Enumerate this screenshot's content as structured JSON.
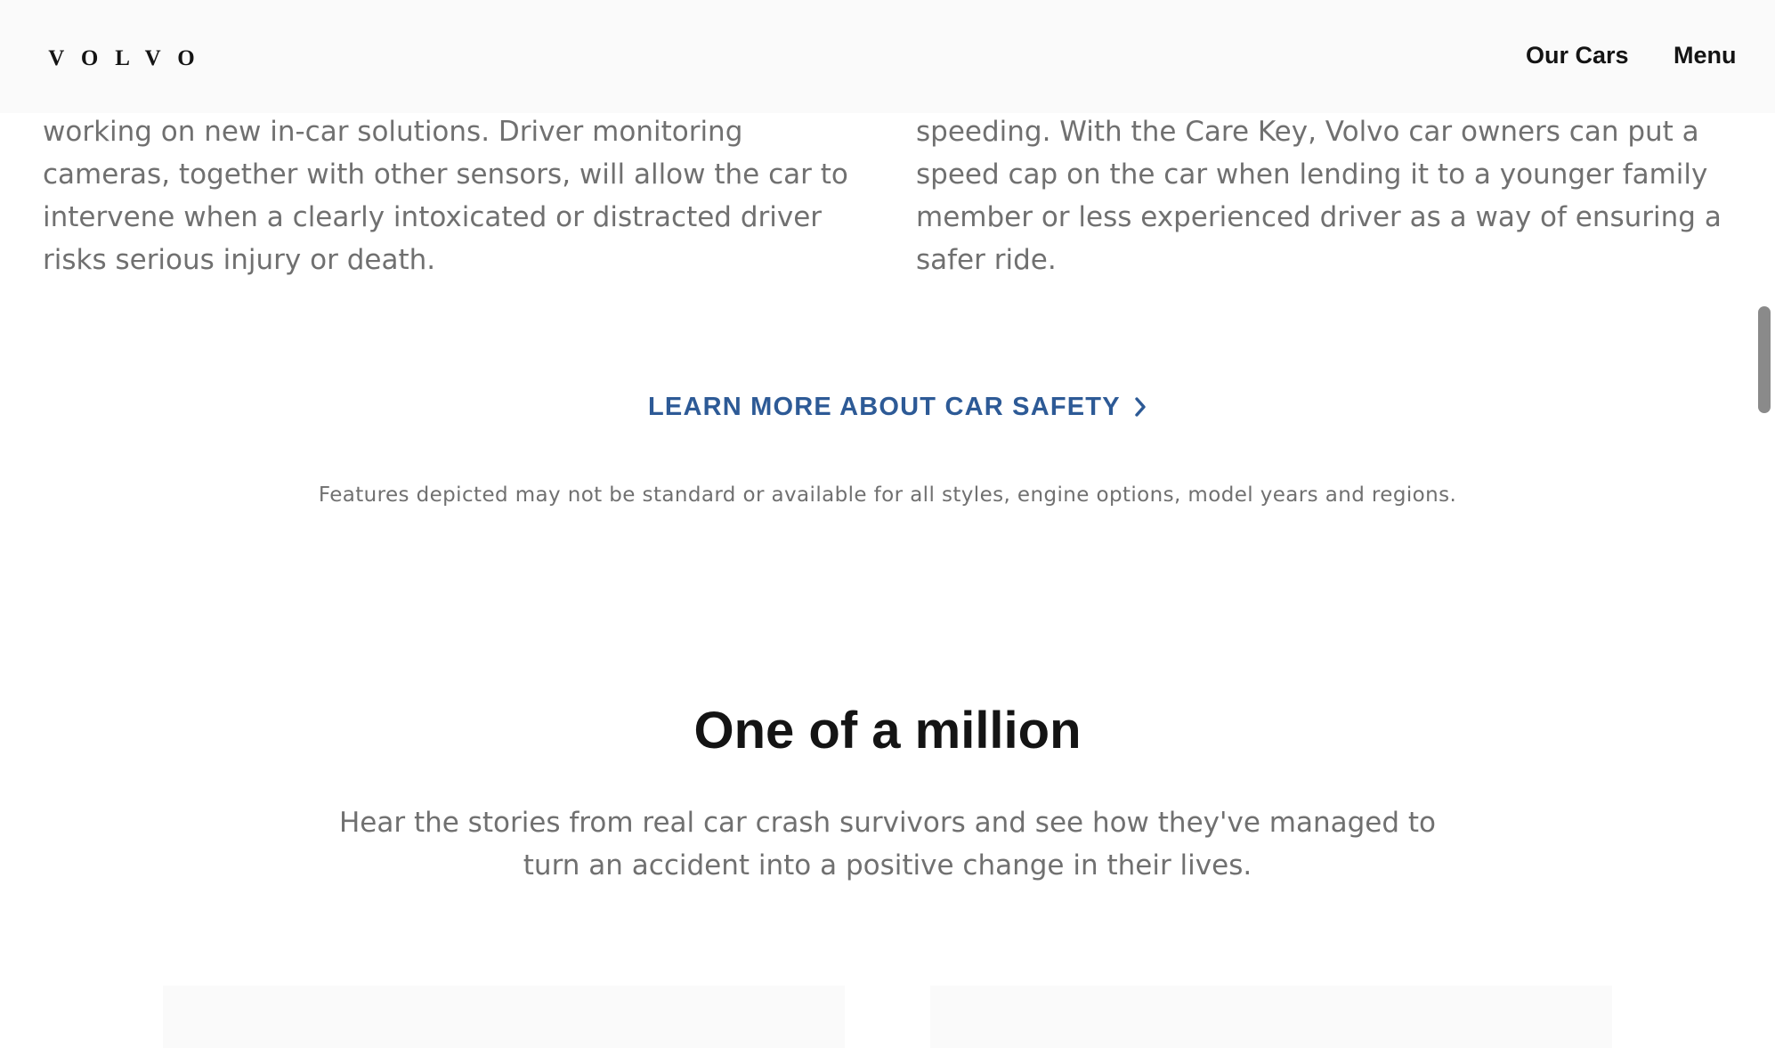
{
  "header": {
    "logo_text": "VOLVO",
    "nav": {
      "our_cars": "Our Cars",
      "menu": "Menu"
    }
  },
  "columns": {
    "left_text": "working on new in-car solutions. Driver monitoring cameras, together with other sensors, will allow the car to intervene when a clearly intoxicated or distracted driver risks serious injury or death.",
    "right_text": "speeding. With the Care Key, Volvo car owners can put a speed cap on the car when lending it to a younger family member or less experienced driver as a way of ensuring a safer ride."
  },
  "cta": {
    "label": "LEARN MORE ABOUT CAR SAFETY",
    "icon": "chevron-right-icon",
    "color": "#2d5a96"
  },
  "disclaimer": "Features depicted may not be standard or available for all styles, engine options, model years and regions.",
  "section": {
    "title": "One of a million",
    "subtitle": "Hear the stories from real car crash survivors and see how they've managed to turn an accident into a positive change in their lives."
  }
}
